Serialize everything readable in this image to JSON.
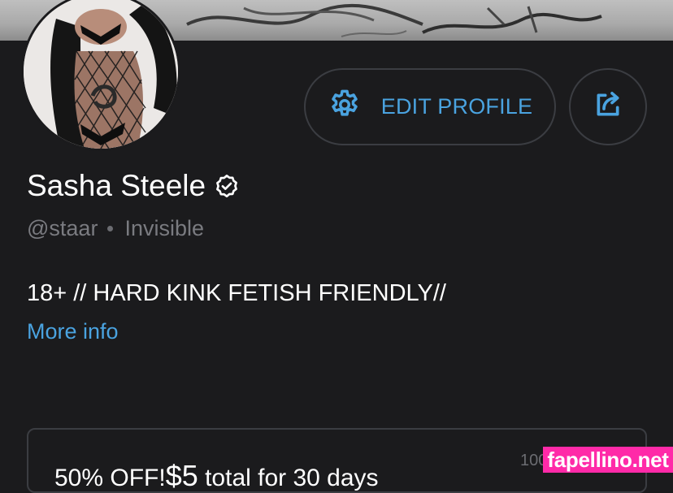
{
  "profile": {
    "name": "Sasha Steele",
    "handle": "@staar",
    "status": "Invisible",
    "bio": "18+ // HARD KINK FETISH FRIENDLY//",
    "more_info": "More info"
  },
  "buttons": {
    "edit_profile": "EDIT PROFILE"
  },
  "promo": {
    "discount": "50% OFF!",
    "price": "$5",
    "terms": " total for 30 days",
    "cut_text": "100"
  },
  "watermark": "fapellino.net",
  "colors": {
    "background": "#1b1b1d",
    "accent": "#4aa3e0",
    "muted": "#7a7b80",
    "border": "#3b3d42",
    "watermark": "#ff2aa8"
  },
  "icons": {
    "edit": "gear-icon",
    "share": "share-icon",
    "verified": "verified-badge-icon"
  }
}
